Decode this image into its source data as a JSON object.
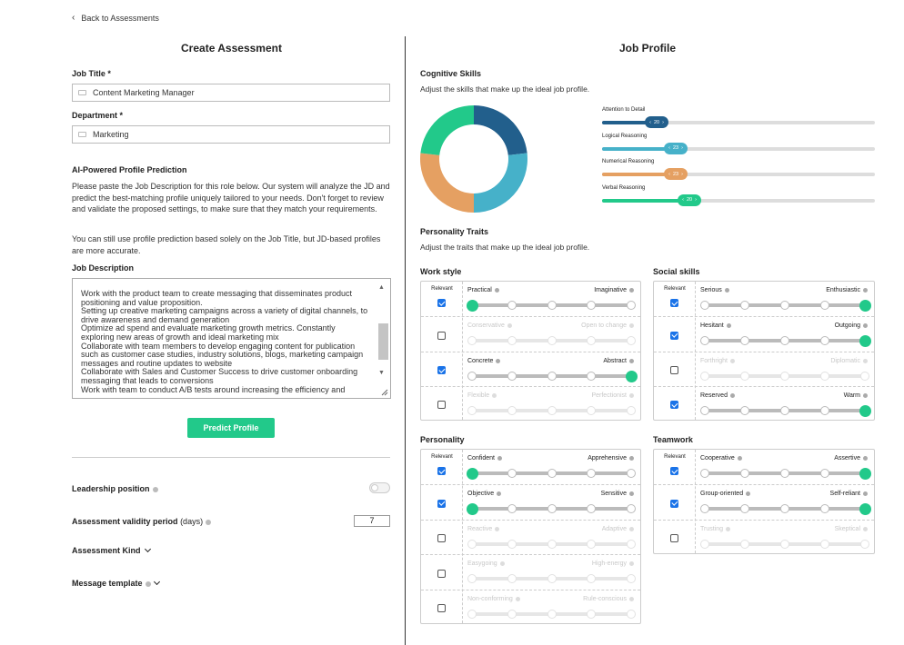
{
  "nav": {
    "back_label": "Back to Assessments"
  },
  "left": {
    "title": "Create Assessment",
    "job_title_label": "Job Title *",
    "job_title_value": "Content Marketing Manager",
    "department_label": "Department *",
    "department_value": "Marketing",
    "ai_heading": "AI-Powered Profile Prediction",
    "ai_para1": "Please paste the Job Description for this role below. Our system will analyze the JD and predict the best-matching profile uniquely tailored to your needs. Don't forget to review and validate the proposed settings, to make sure that they match your requirements.",
    "ai_para2": "You can still use profile prediction based solely on the Job Title, but JD-based profiles are more accurate.",
    "jd_label": "Job Description",
    "jd_text": "Work with the product team to create messaging that disseminates product positioning and value proposition.\nSetting up creative marketing campaigns across a variety of digital channels, to drive awareness and demand generation\nOptimize ad spend and evaluate marketing growth metrics. Constantly exploring new areas of growth and ideal marketing mix\nCollaborate with team members to develop engaging content for publication such as customer case studies, industry solutions, blogs, marketing campaign messages and routine updates to website\nCollaborate with Sales and Customer Success to drive customer onboarding messaging that leads to conversions\nWork with team to conduct A/B tests around increasing the efficiency and",
    "predict_label": "Predict Profile",
    "leadership_label": "Leadership position",
    "leadership_on": false,
    "validity_label": "Assessment validity period",
    "validity_unit": "(days)",
    "validity_value": "7",
    "kind_label": "Assessment Kind",
    "message_label": "Message template"
  },
  "right": {
    "title": "Job Profile",
    "cog_heading": "Cognitive Skills",
    "cog_sub": "Adjust the skills that make up the ideal job profile.",
    "cog_skills": [
      {
        "label": "Attention to Detail",
        "value": 20,
        "fill": 0.19,
        "color": "#225f8c"
      },
      {
        "label": "Logical Reasoning",
        "value": 23,
        "fill": 0.26,
        "color": "#46b1c9"
      },
      {
        "label": "Numerical Reasoning",
        "value": 23,
        "fill": 0.26,
        "color": "#e5a062"
      },
      {
        "label": "Verbal Reasoning",
        "value": 20,
        "fill": 0.31,
        "color": "#22c98a"
      }
    ],
    "donut_colors": [
      "#225f8c",
      "#46b1c9",
      "#e5a062",
      "#22c98a"
    ],
    "pers_heading": "Personality Traits",
    "pers_sub": "Adjust the traits that make up the ideal job profile.",
    "relevant_label": "Relevant",
    "groups": [
      {
        "title": "Work style",
        "rows": [
          {
            "left": "Practical",
            "right": "Imaginative",
            "relevant": true,
            "pos": 0
          },
          {
            "left": "Conservative",
            "right": "Open to change",
            "relevant": false,
            "pos": -1
          },
          {
            "left": "Concrete",
            "right": "Abstract",
            "relevant": true,
            "pos": 4
          },
          {
            "left": "Flexible",
            "right": "Perfectionist",
            "relevant": false,
            "pos": -1
          }
        ]
      },
      {
        "title": "Social skills",
        "rows": [
          {
            "left": "Serious",
            "right": "Enthusiastic",
            "relevant": true,
            "pos": 4
          },
          {
            "left": "Hesitant",
            "right": "Outgoing",
            "relevant": true,
            "pos": 4
          },
          {
            "left": "Forthright",
            "right": "Diplomatic",
            "relevant": false,
            "pos": -1
          },
          {
            "left": "Reserved",
            "right": "Warm",
            "relevant": true,
            "pos": 4
          }
        ]
      },
      {
        "title": "Personality",
        "rows": [
          {
            "left": "Confident",
            "right": "Apprehensive",
            "relevant": true,
            "pos": 0
          },
          {
            "left": "Objective",
            "right": "Sensitive",
            "relevant": true,
            "pos": 0
          },
          {
            "left": "Reactive",
            "right": "Adaptive",
            "relevant": false,
            "pos": -1
          },
          {
            "left": "Easygoing",
            "right": "High-energy",
            "relevant": false,
            "pos": -1
          },
          {
            "left": "Non-conforming",
            "right": "Rule-conscious",
            "relevant": false,
            "pos": -1
          }
        ]
      },
      {
        "title": "Teamwork",
        "rows": [
          {
            "left": "Cooperative",
            "right": "Assertive",
            "relevant": true,
            "pos": 4
          },
          {
            "left": "Group-oriented",
            "right": "Self-reliant",
            "relevant": true,
            "pos": 4
          },
          {
            "left": "Trusting",
            "right": "Skeptical",
            "relevant": false,
            "pos": -1
          }
        ]
      }
    ]
  }
}
